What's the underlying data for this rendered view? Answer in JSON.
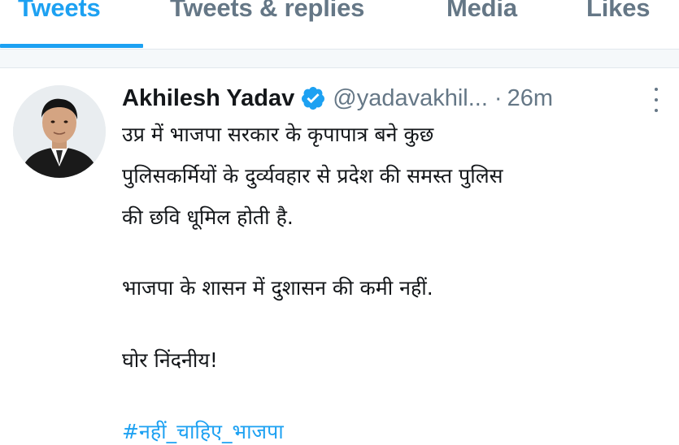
{
  "tabs": [
    {
      "label": "Tweets",
      "active": true
    },
    {
      "label": "Tweets & replies",
      "active": false
    },
    {
      "label": "Media",
      "active": false
    },
    {
      "label": "Likes",
      "active": false
    }
  ],
  "tweet": {
    "author_name": "Akhilesh Yadav",
    "verified": true,
    "handle": "@yadavakhil...",
    "separator": "·",
    "time": "26m",
    "lines": [
      "उप्र में भाजपा सरकार के कृपापात्र बने कुछ",
      "पुलिसकर्मियों के दुर्व्यवहार से प्रदेश की समस्त पुलिस",
      "की छवि धूमिल होती है.",
      "भाजपा के शासन में दुशासन की कमी नहीं.",
      "घोर निंदनीय!"
    ],
    "hashtag": "#नहीं_चाहिए_भाजपा"
  },
  "colors": {
    "accent": "#1da1f2",
    "muted_text": "#657786",
    "primary_text": "#14171a",
    "divider": "#e1e8ed"
  },
  "icons": {
    "verified": "verified-badge-icon",
    "more": "more-vertical-icon"
  }
}
